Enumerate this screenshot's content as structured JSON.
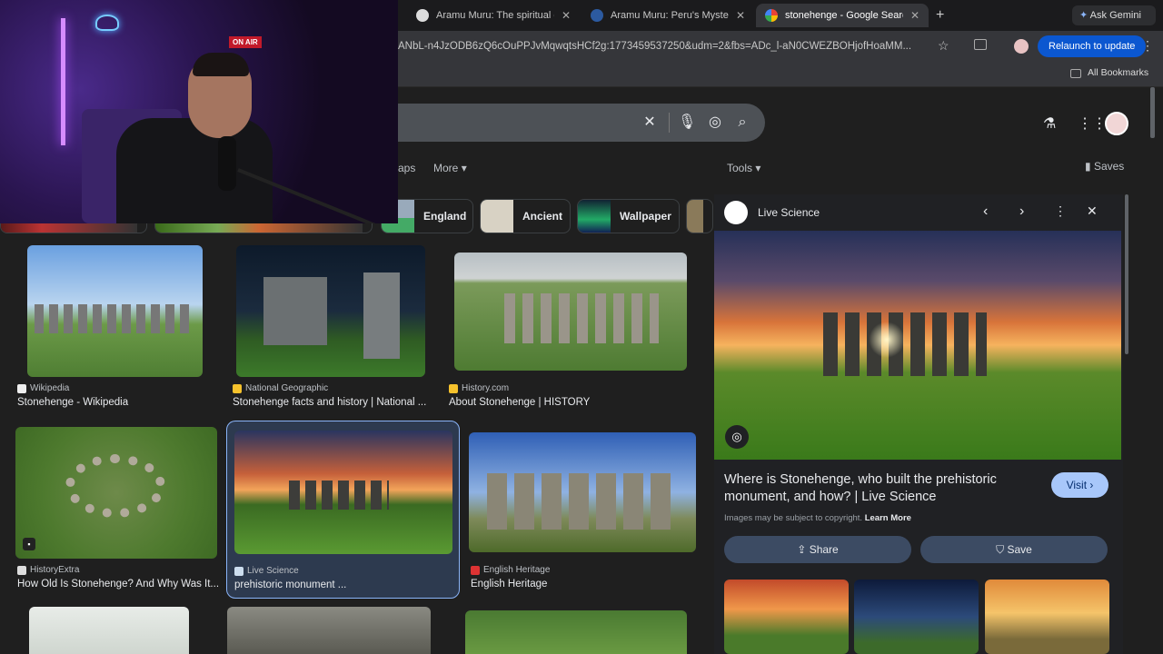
{
  "browser": {
    "tabs": [
      {
        "label": "Aramu Muru: The spiritual do"
      },
      {
        "label": "Aramu Muru: Peru's Mysterio"
      },
      {
        "label": "stonehenge - Google Search"
      }
    ],
    "ask_gemini": "Ask Gemini",
    "url": "ANbL-n4JzODB6zQ6cOuPPJvMqwqtsHCf2g:1773459537250&udm=2&fbs=ADc_l-aN0CWEZBOHjofHoaMM...",
    "relaunch": "Relaunch to update",
    "all_bookmarks": "All Bookmarks"
  },
  "search": {
    "filters": {
      "maps": "aps",
      "more": "More",
      "tools": "Tools",
      "saves": "Saves"
    },
    "chips": [
      {
        "label": "England"
      },
      {
        "label": "Ancient"
      },
      {
        "label": "Wallpaper"
      }
    ]
  },
  "results": [
    {
      "source": "Wikipedia",
      "title": "Stonehenge - Wikipedia"
    },
    {
      "source": "National Geographic",
      "title": "Stonehenge facts and history | National ..."
    },
    {
      "source": "History.com",
      "title": "About Stonehenge | HISTORY"
    },
    {
      "source": "HistoryExtra",
      "title": "How Old Is Stonehenge? And Why Was It..."
    },
    {
      "source": "Live Science",
      "title": "prehistoric monument ..."
    },
    {
      "source": "English Heritage",
      "title": "English Heritage"
    }
  ],
  "panel": {
    "source": "Live Science",
    "title": "Where is Stonehenge, who built the prehistoric monument, and how? | Live Science",
    "visit": "Visit",
    "copyright": "Images may be subject to copyright.",
    "learn_more": "Learn More",
    "share": "Share",
    "save": "Save"
  },
  "webcam": {
    "sign": "ON AIR"
  },
  "colors": {
    "accent": "#8ab4f8",
    "relaunch": "#0b57d0",
    "visit_btn": "#a8c7fa",
    "background": "#1f1f1f"
  }
}
